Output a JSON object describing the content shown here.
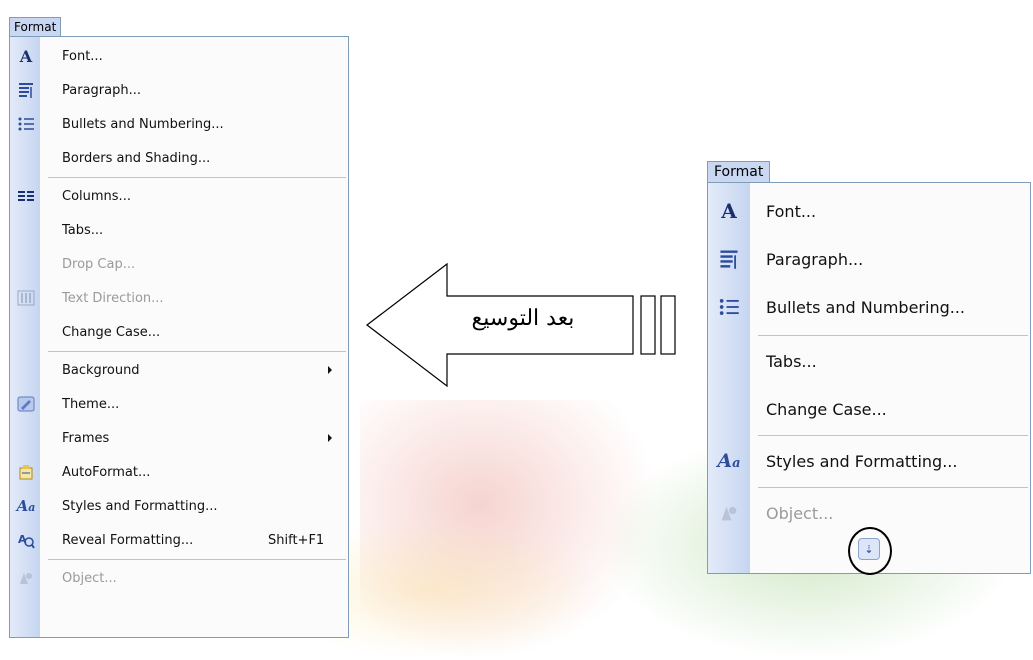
{
  "left_menu": {
    "title": "Format",
    "items": [
      {
        "label": "Font...",
        "icon": "font-icon",
        "disabled": false
      },
      {
        "label": "Paragraph...",
        "icon": "paragraph-icon",
        "disabled": false
      },
      {
        "label": "Bullets and Numbering...",
        "icon": "bullets-icon",
        "disabled": false
      },
      {
        "label": "Borders and Shading...",
        "icon": "",
        "disabled": false
      },
      {
        "label": "Columns...",
        "icon": "columns-icon",
        "disabled": false
      },
      {
        "label": "Tabs...",
        "icon": "",
        "disabled": false
      },
      {
        "label": "Drop Cap...",
        "icon": "",
        "disabled": true
      },
      {
        "label": "Text Direction...",
        "icon": "text-direction-icon",
        "disabled": true
      },
      {
        "label": "Change Case...",
        "icon": "",
        "disabled": false
      },
      {
        "label": "Background",
        "icon": "",
        "disabled": false,
        "submenu": true
      },
      {
        "label": "Theme...",
        "icon": "theme-icon",
        "disabled": false
      },
      {
        "label": "Frames",
        "icon": "",
        "disabled": false,
        "submenu": true
      },
      {
        "label": "AutoFormat...",
        "icon": "autoformat-icon",
        "disabled": false
      },
      {
        "label": "Styles and Formatting...",
        "icon": "styles-icon",
        "disabled": false
      },
      {
        "label": "Reveal Formatting...",
        "icon": "reveal-formatting-icon",
        "disabled": false,
        "shortcut": "Shift+F1"
      },
      {
        "label": "Object...",
        "icon": "object-icon",
        "disabled": true
      }
    ]
  },
  "right_menu": {
    "title": "Format",
    "items": [
      {
        "label": "Font...",
        "icon": "font-icon",
        "disabled": false
      },
      {
        "label": "Paragraph...",
        "icon": "paragraph-icon",
        "disabled": false
      },
      {
        "label": "Bullets and Numbering...",
        "icon": "bullets-icon",
        "disabled": false
      },
      {
        "label": "Tabs...",
        "icon": "",
        "disabled": false
      },
      {
        "label": "Change Case...",
        "icon": "",
        "disabled": false
      },
      {
        "label": "Styles and Formatting...",
        "icon": "styles-icon",
        "disabled": false
      },
      {
        "label": "Object...",
        "icon": "object-icon",
        "disabled": true
      }
    ],
    "expand_icon": "chevron-double-down-icon"
  },
  "arrow": {
    "label": "بعد التوسيع"
  }
}
